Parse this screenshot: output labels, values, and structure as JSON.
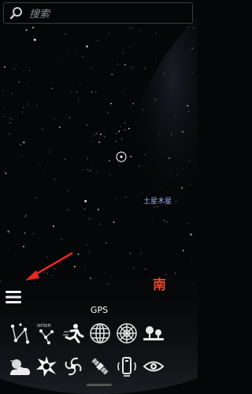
{
  "search": {
    "placeholder": "搜索"
  },
  "sky": {
    "planet_label": "土星木星",
    "direction_label": "南"
  },
  "gps_label": "GPS",
  "toolbar": {
    "row1": [
      "constellation-lines-icon",
      "constellation-names-icon",
      "deep-sky-icon",
      "grid-equatorial-icon",
      "grid-azimuthal-icon",
      "landscape-icon"
    ],
    "row2": [
      "atmosphere-icon",
      "star-burst-icon",
      "galaxy-icon",
      "satellite-icon",
      "phone-icon",
      "eye-icon"
    ],
    "orion_text": "orion"
  },
  "colors": {
    "background": "#050608",
    "planet_label": "#a7aef0",
    "direction_label": "#e2452b",
    "arrow": "#e52a20"
  }
}
